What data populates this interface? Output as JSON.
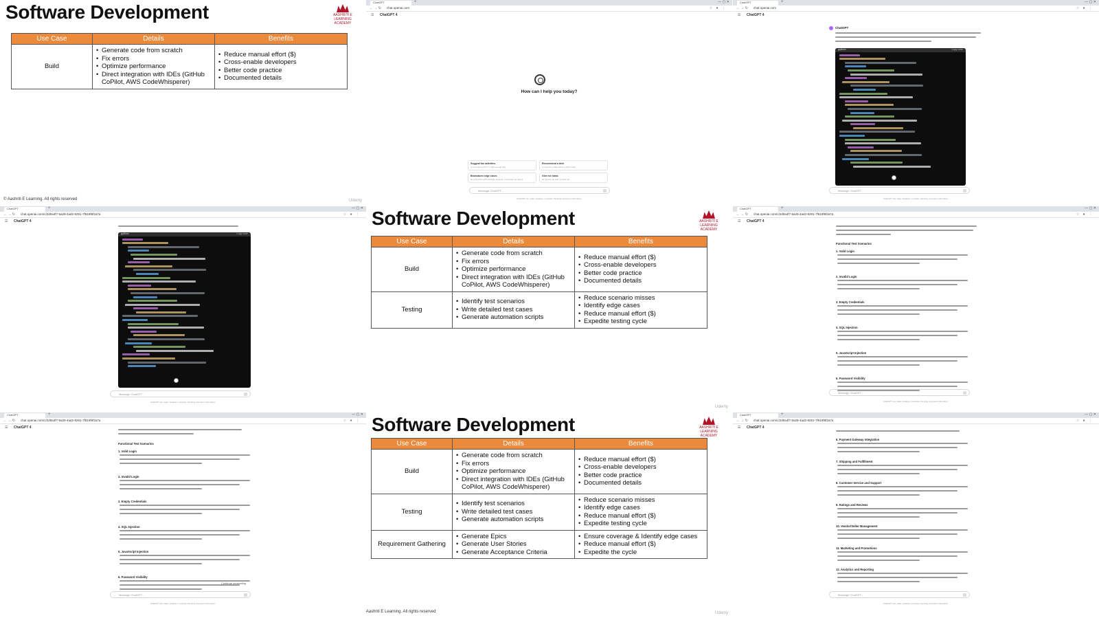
{
  "slide": {
    "title": "Software Development",
    "logo_text": "AASHRITI E LEARNING ACADEMY",
    "footer": "© Aashriti E Learning. All rights reserved",
    "watermark": "Udemy",
    "headers": [
      "Use Case",
      "Details",
      "Benefits"
    ],
    "rows": [
      {
        "use_case": "Build",
        "details": [
          "Generate code from scratch",
          "Fix errors",
          "Optimize performance",
          "Direct integration with IDEs (GitHub CoPilot, AWS CodeWhisperer)"
        ],
        "benefits": [
          "Reduce manual effort ($)",
          "Cross-enable developers",
          "Better code practice",
          "Documented details"
        ]
      },
      {
        "use_case": "Testing",
        "details": [
          "Identify test scenarios",
          "Write detailed test cases",
          "Generate automation scripts"
        ],
        "benefits": [
          "Reduce scenario misses",
          "Identify edge cases",
          "Reduce manual effort ($)",
          "Expedite testing cycle"
        ]
      },
      {
        "use_case": "Requirement Gathering",
        "details": [
          "Generate Epics",
          "Generate User Stories",
          "Generate Acceptance Criteria"
        ],
        "benefits": [
          "Ensure coverage & Identify edge cases",
          "Reduce manual effort ($)",
          "Expedite the cycle"
        ]
      }
    ]
  },
  "browser": {
    "tab_label": "ChatGPT",
    "url": "chat.openai.com",
    "url_long": "chat.openai.com/c/2d0a4f7-5a29-4ad2-8291-7f619f6f2a7a",
    "model_label": "ChatGPT 4",
    "help_text": "How can I help you today?",
    "message_placeholder": "Message ChatGPT...",
    "disclaimer": "ChatGPT can make mistakes. Consider checking important information.",
    "suggestions": [
      {
        "title": "Suggest fun activities",
        "sub": "to do indoors with my high-energy dog"
      },
      {
        "title": "Recommend a dish",
        "sub": "to impress a date who's a picky eater"
      },
      {
        "title": "Brainstorm edge cases",
        "sub": "for a function with birthdate as input, horoscope as output"
      },
      {
        "title": "Give me ideas",
        "sub": "for what to do with my kids' art"
      }
    ],
    "assistant_name": "ChatGPT",
    "code_header": "python",
    "copy_label": "Copy code",
    "continue_label": "Continue generating"
  },
  "doc": {
    "functional_title": "Functional Test Scenarios",
    "scenarios": [
      "1. Valid Login",
      "2. Invalid Login",
      "3. Empty Credentials",
      "4. SQL Injection",
      "5. JavaScript Injection",
      "6. Password Visibility"
    ],
    "ecommerce_sections": [
      "6. Payment Gateway Integration",
      "7. Shipping and Fulfillment",
      "8. Customer Service and Support",
      "9. Ratings and Reviews",
      "10. Vendor/Seller Management",
      "11. Marketing and Promotions",
      "12. Analytics and Reporting"
    ]
  },
  "colors": {
    "table_header": "#ec8a3c",
    "logo": "#b0162a",
    "code_bg": "#0d0d0d"
  }
}
